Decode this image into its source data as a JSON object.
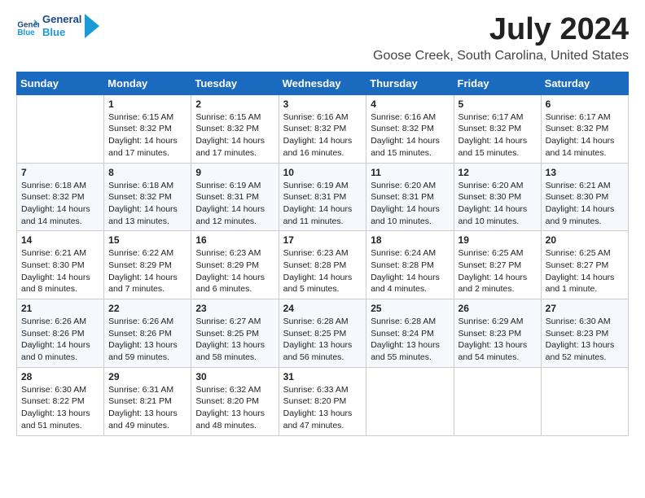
{
  "logo": {
    "text_general": "General",
    "text_blue": "Blue"
  },
  "title": "July 2024",
  "location": "Goose Creek, South Carolina, United States",
  "days_of_week": [
    "Sunday",
    "Monday",
    "Tuesday",
    "Wednesday",
    "Thursday",
    "Friday",
    "Saturday"
  ],
  "weeks": [
    [
      {
        "day": "",
        "info": ""
      },
      {
        "day": "1",
        "info": "Sunrise: 6:15 AM\nSunset: 8:32 PM\nDaylight: 14 hours\nand 17 minutes."
      },
      {
        "day": "2",
        "info": "Sunrise: 6:15 AM\nSunset: 8:32 PM\nDaylight: 14 hours\nand 17 minutes."
      },
      {
        "day": "3",
        "info": "Sunrise: 6:16 AM\nSunset: 8:32 PM\nDaylight: 14 hours\nand 16 minutes."
      },
      {
        "day": "4",
        "info": "Sunrise: 6:16 AM\nSunset: 8:32 PM\nDaylight: 14 hours\nand 15 minutes."
      },
      {
        "day": "5",
        "info": "Sunrise: 6:17 AM\nSunset: 8:32 PM\nDaylight: 14 hours\nand 15 minutes."
      },
      {
        "day": "6",
        "info": "Sunrise: 6:17 AM\nSunset: 8:32 PM\nDaylight: 14 hours\nand 14 minutes."
      }
    ],
    [
      {
        "day": "7",
        "info": "Sunrise: 6:18 AM\nSunset: 8:32 PM\nDaylight: 14 hours\nand 14 minutes."
      },
      {
        "day": "8",
        "info": "Sunrise: 6:18 AM\nSunset: 8:32 PM\nDaylight: 14 hours\nand 13 minutes."
      },
      {
        "day": "9",
        "info": "Sunrise: 6:19 AM\nSunset: 8:31 PM\nDaylight: 14 hours\nand 12 minutes."
      },
      {
        "day": "10",
        "info": "Sunrise: 6:19 AM\nSunset: 8:31 PM\nDaylight: 14 hours\nand 11 minutes."
      },
      {
        "day": "11",
        "info": "Sunrise: 6:20 AM\nSunset: 8:31 PM\nDaylight: 14 hours\nand 10 minutes."
      },
      {
        "day": "12",
        "info": "Sunrise: 6:20 AM\nSunset: 8:30 PM\nDaylight: 14 hours\nand 10 minutes."
      },
      {
        "day": "13",
        "info": "Sunrise: 6:21 AM\nSunset: 8:30 PM\nDaylight: 14 hours\nand 9 minutes."
      }
    ],
    [
      {
        "day": "14",
        "info": "Sunrise: 6:21 AM\nSunset: 8:30 PM\nDaylight: 14 hours\nand 8 minutes."
      },
      {
        "day": "15",
        "info": "Sunrise: 6:22 AM\nSunset: 8:29 PM\nDaylight: 14 hours\nand 7 minutes."
      },
      {
        "day": "16",
        "info": "Sunrise: 6:23 AM\nSunset: 8:29 PM\nDaylight: 14 hours\nand 6 minutes."
      },
      {
        "day": "17",
        "info": "Sunrise: 6:23 AM\nSunset: 8:28 PM\nDaylight: 14 hours\nand 5 minutes."
      },
      {
        "day": "18",
        "info": "Sunrise: 6:24 AM\nSunset: 8:28 PM\nDaylight: 14 hours\nand 4 minutes."
      },
      {
        "day": "19",
        "info": "Sunrise: 6:25 AM\nSunset: 8:27 PM\nDaylight: 14 hours\nand 2 minutes."
      },
      {
        "day": "20",
        "info": "Sunrise: 6:25 AM\nSunset: 8:27 PM\nDaylight: 14 hours\nand 1 minute."
      }
    ],
    [
      {
        "day": "21",
        "info": "Sunrise: 6:26 AM\nSunset: 8:26 PM\nDaylight: 14 hours\nand 0 minutes."
      },
      {
        "day": "22",
        "info": "Sunrise: 6:26 AM\nSunset: 8:26 PM\nDaylight: 13 hours\nand 59 minutes."
      },
      {
        "day": "23",
        "info": "Sunrise: 6:27 AM\nSunset: 8:25 PM\nDaylight: 13 hours\nand 58 minutes."
      },
      {
        "day": "24",
        "info": "Sunrise: 6:28 AM\nSunset: 8:25 PM\nDaylight: 13 hours\nand 56 minutes."
      },
      {
        "day": "25",
        "info": "Sunrise: 6:28 AM\nSunset: 8:24 PM\nDaylight: 13 hours\nand 55 minutes."
      },
      {
        "day": "26",
        "info": "Sunrise: 6:29 AM\nSunset: 8:23 PM\nDaylight: 13 hours\nand 54 minutes."
      },
      {
        "day": "27",
        "info": "Sunrise: 6:30 AM\nSunset: 8:23 PM\nDaylight: 13 hours\nand 52 minutes."
      }
    ],
    [
      {
        "day": "28",
        "info": "Sunrise: 6:30 AM\nSunset: 8:22 PM\nDaylight: 13 hours\nand 51 minutes."
      },
      {
        "day": "29",
        "info": "Sunrise: 6:31 AM\nSunset: 8:21 PM\nDaylight: 13 hours\nand 49 minutes."
      },
      {
        "day": "30",
        "info": "Sunrise: 6:32 AM\nSunset: 8:20 PM\nDaylight: 13 hours\nand 48 minutes."
      },
      {
        "day": "31",
        "info": "Sunrise: 6:33 AM\nSunset: 8:20 PM\nDaylight: 13 hours\nand 47 minutes."
      },
      {
        "day": "",
        "info": ""
      },
      {
        "day": "",
        "info": ""
      },
      {
        "day": "",
        "info": ""
      }
    ]
  ]
}
